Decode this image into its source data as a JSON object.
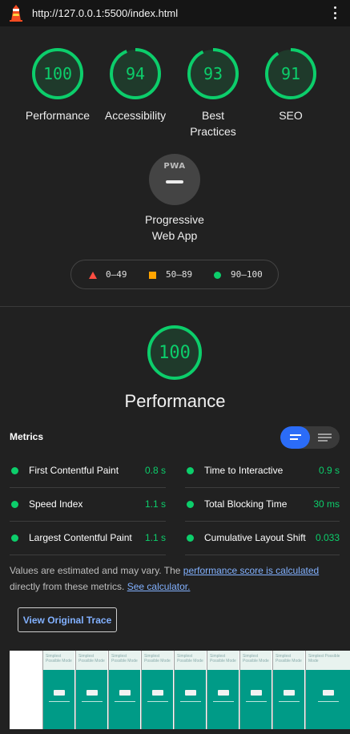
{
  "browser": {
    "url": "http://127.0.0.1:5500/index.html"
  },
  "scores": [
    {
      "label": "Performance",
      "value": "100",
      "fraction": 1.0
    },
    {
      "label": "Accessibility",
      "value": "94",
      "fraction": 0.94
    },
    {
      "label": "Best Practices",
      "value": "93",
      "fraction": 0.93
    },
    {
      "label": "SEO",
      "value": "91",
      "fraction": 0.91
    }
  ],
  "pwa": {
    "badge": "PWA",
    "label_line1": "Progressive",
    "label_line2": "Web App"
  },
  "legend": {
    "fail": "0–49",
    "average": "50–89",
    "pass": "90–100"
  },
  "performance": {
    "score": "100",
    "fraction": 1.0,
    "title": "Performance"
  },
  "metrics": {
    "title": "Metrics",
    "items": [
      {
        "name": "First Contentful Paint",
        "value": "0.8 s"
      },
      {
        "name": "Time to Interactive",
        "value": "0.9 s"
      },
      {
        "name": "Speed Index",
        "value": "1.1 s"
      },
      {
        "name": "Total Blocking Time",
        "value": "30 ms"
      },
      {
        "name": "Largest Contentful Paint",
        "value": "1.1 s"
      },
      {
        "name": "Cumulative Layout Shift",
        "value": "0.033"
      }
    ]
  },
  "note": {
    "text1": "Values are estimated and may vary. The ",
    "link1": "performance score is calculated",
    "text2": " directly from these metrics. ",
    "link2": "See calculator."
  },
  "trace_button": "View Original Trace",
  "filmstrip": {
    "frame_title": "Simplest Possible Mode"
  },
  "colors": {
    "pass": "#0cce6b",
    "average": "#ffa400",
    "fail": "#ff4e42",
    "toggle_active": "#2b6cf7",
    "link": "#82b1ff"
  },
  "icons": [
    "lighthouse-logo-icon",
    "more-vert-icon",
    "pwa-badge-icon",
    "metrics-expanded-view-icon",
    "metrics-list-view-icon"
  ]
}
